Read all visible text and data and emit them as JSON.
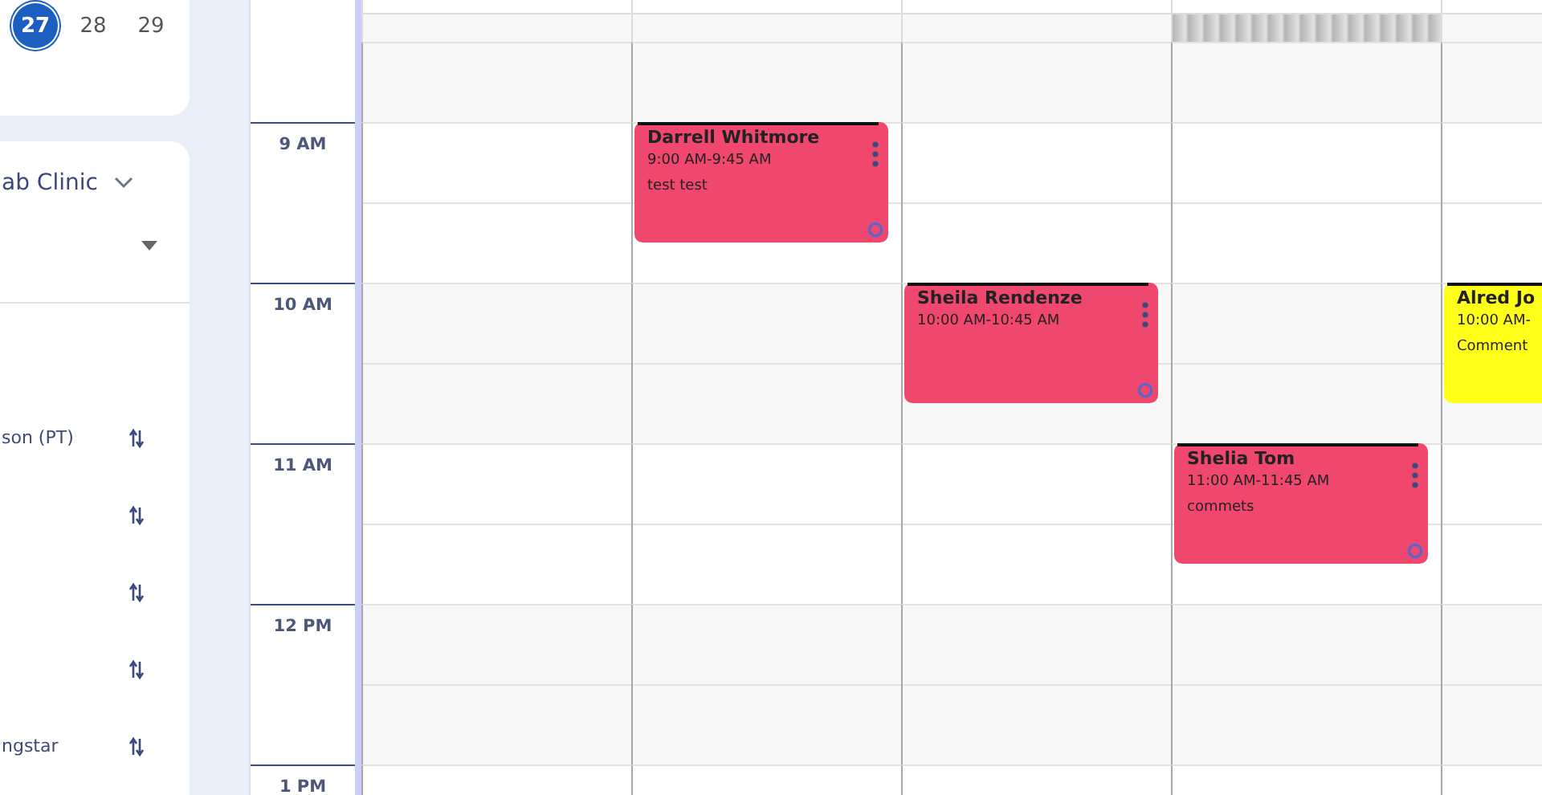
{
  "mini_calendar": {
    "dates": [
      {
        "label": "27",
        "selected": true
      },
      {
        "label": "28",
        "selected": false
      },
      {
        "label": "29",
        "selected": false
      }
    ]
  },
  "filter_panel": {
    "location": "ab Clinic",
    "providers": [
      {
        "label": "son (PT)",
        "sortable": true
      },
      {
        "sortable": true
      },
      {
        "sortable": true
      },
      {
        "sortable": true
      },
      {
        "label": "ngstar",
        "sortable": true
      }
    ]
  },
  "all_day": [
    {
      "blocked": false
    },
    {
      "blocked": false
    },
    {
      "blocked": false
    },
    {
      "blocked": true
    },
    {
      "blocked": false
    }
  ],
  "rows": [
    {
      "cells": [
        {},
        {},
        {},
        {},
        {}
      ]
    },
    {
      "time": "9 AM",
      "cells": [
        {},
        {
          "event": {
            "name": "Darrell Whitmore",
            "time": "9:00 AM-9:45 AM",
            "note": "test test",
            "color": "#f0476f",
            "actions": true
          }
        },
        {},
        {},
        {}
      ]
    },
    {
      "time": "10 AM",
      "cells": [
        {},
        {},
        {
          "event": {
            "name": "Sheila Rendenze",
            "time": "10:00 AM-10:45 AM",
            "color": "#f0476f",
            "actions": true
          }
        },
        {},
        {
          "event": {
            "name": "Alred Jo",
            "time": "10:00 AM-",
            "note": "Comment",
            "color": "#ffff1a"
          }
        }
      ]
    },
    {
      "time": "11 AM",
      "cells": [
        {},
        {},
        {},
        {
          "event": {
            "name": "Shelia Tom",
            "time": "11:00 AM-11:45 AM",
            "note": "commets",
            "color": "#f0476f",
            "actions": true
          }
        },
        {}
      ]
    },
    {
      "time": "12 PM",
      "cells": [
        {},
        {},
        {},
        {},
        {}
      ]
    },
    {
      "time": "1 PM",
      "cells": [
        {},
        {},
        {},
        {},
        {}
      ]
    }
  ]
}
